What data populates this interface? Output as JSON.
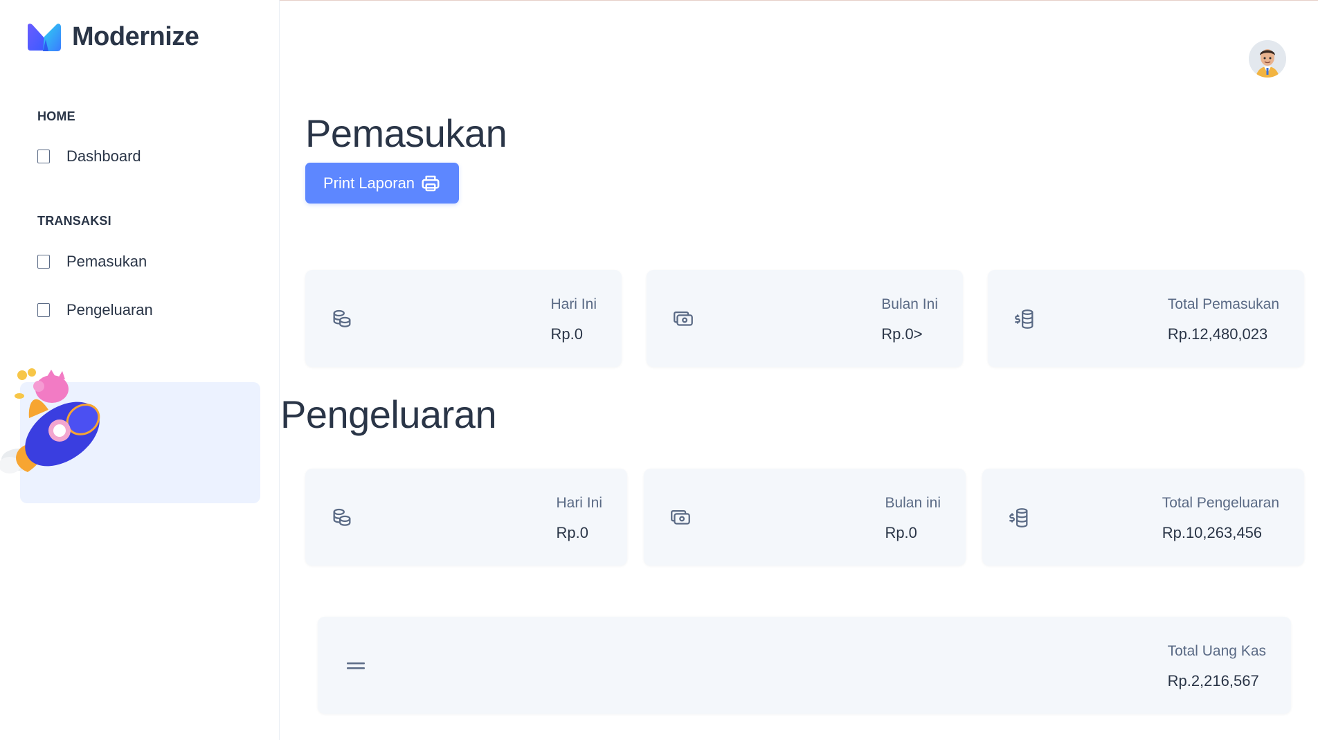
{
  "app": {
    "name": "Modernize"
  },
  "sidebar": {
    "sections": [
      {
        "caption": "HOME",
        "items": [
          {
            "label": "Dashboard"
          }
        ]
      },
      {
        "caption": "TRANSAKSI",
        "items": [
          {
            "label": "Pemasukan"
          },
          {
            "label": "Pengeluaran"
          }
        ]
      }
    ]
  },
  "pemasukan": {
    "title": "Pemasukan",
    "print_button": "Print Laporan",
    "cards": [
      {
        "label": "Hari Ini",
        "value": "Rp.0",
        "icon": "coins-icon"
      },
      {
        "label": "Bulan Ini",
        "value": "Rp.0>",
        "icon": "cash-icon"
      },
      {
        "label": "Total Pemasukan",
        "value": "Rp.12,480,023",
        "icon": "dollar-stack-icon"
      }
    ]
  },
  "pengeluaran": {
    "title": "Pengeluaran",
    "cards": [
      {
        "label": "Hari Ini",
        "value": "Rp.0",
        "icon": "coins-icon"
      },
      {
        "label": "Bulan ini",
        "value": "Rp.0",
        "icon": "cash-icon"
      },
      {
        "label": "Total Pengeluaran",
        "value": "Rp.10,263,456",
        "icon": "dollar-stack-icon"
      }
    ]
  },
  "kas": {
    "label": "Total Uang Kas",
    "value": "Rp.2,216,567",
    "icon": "equals-icon"
  },
  "colors": {
    "primary": "#5d87ff",
    "card_bg": "#f4f7fb",
    "text": "#2a3547",
    "muted": "#5a6a85"
  }
}
